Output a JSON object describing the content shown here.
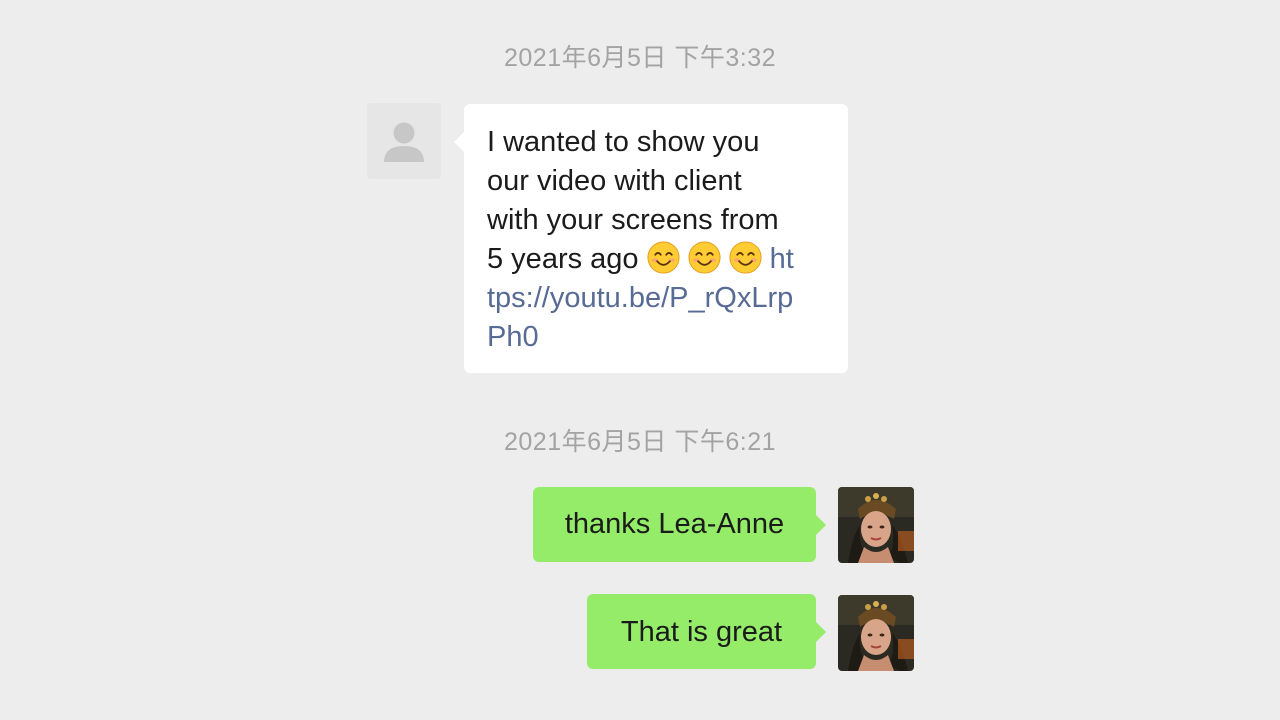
{
  "chat": {
    "timestamps": [
      "2021年6月5日 下午3:32",
      "2021年6月5日 下午6:21"
    ],
    "incoming": {
      "avatar_icon": "default-user-icon",
      "line1": "I wanted to show you",
      "line2": "our video with client",
      "line3": "with your screens from",
      "line4_text": "5 years ago ",
      "emoji": "smiling-face-icon",
      "link_part1": "ht",
      "link_part2": "tps://youtu.be/P_rQxLrp",
      "link_part3": "Ph0"
    },
    "outgoing": [
      {
        "text": "thanks Lea-Anne",
        "avatar_icon": "profile-photo"
      },
      {
        "text": "That is great",
        "avatar_icon": "profile-photo"
      }
    ]
  },
  "colors": {
    "background": "#ededed",
    "incoming_bubble": "#ffffff",
    "outgoing_bubble": "#95ec69",
    "link": "#576b95",
    "timestamp": "#a3a3a3"
  }
}
